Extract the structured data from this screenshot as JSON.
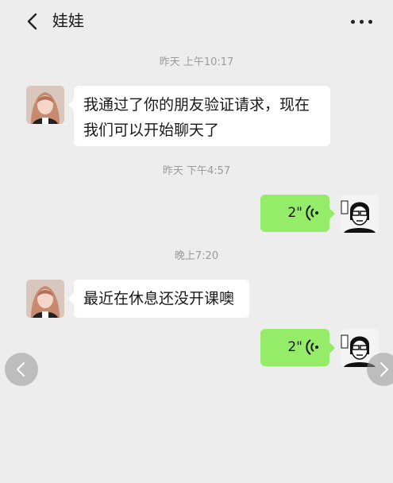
{
  "header": {
    "title": "娃娃",
    "back_icon": "chevron-left-icon",
    "more_icon": "more-dots-icon"
  },
  "messages": {
    "ts1": "昨天 上午10:17",
    "m1_text": "我通过了你的朋友验证请求，现在我们可以开始聊天了",
    "ts2": "昨天 下午4:57",
    "m2_duration": "2\"",
    "ts3": "晚上7:20",
    "m3_text": "最近在休息还没开课噢",
    "m4_duration": "2\""
  },
  "nav": {
    "prev_icon": "chevron-left-icon",
    "next_icon": "chevron-right-icon"
  },
  "colors": {
    "background": "#ededed",
    "incoming_bubble": "#ffffff",
    "outgoing_bubble": "#95ec69",
    "timestamp": "#9b9b9b"
  }
}
